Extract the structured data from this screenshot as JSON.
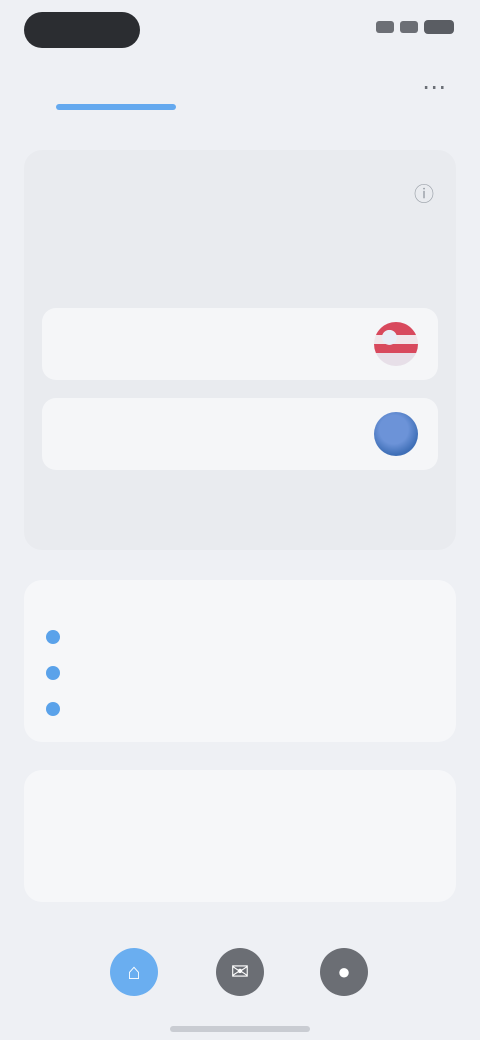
{
  "status_bar": {
    "icons": [
      "signal-icon",
      "wifi-icon",
      "battery-icon"
    ]
  },
  "top_nav": {
    "tabs": [
      {
        "label": ""
      },
      {
        "label": ""
      }
    ],
    "more_icon": "more-icon"
  },
  "connection_panel": {
    "title": "",
    "description": "",
    "options": [
      {
        "label": "",
        "icon": "us-flag-icon"
      },
      {
        "label": "",
        "icon": "uk-flag-icon"
      }
    ],
    "link": ""
  },
  "list_panel": {
    "items": [
      {
        "label": "",
        "value": ""
      },
      {
        "label": "",
        "value": ""
      },
      {
        "label": "",
        "value": ""
      }
    ]
  },
  "info_panel": {
    "heading": "",
    "text": ""
  },
  "tab_bar": {
    "items": [
      {
        "icon": "home-icon"
      },
      {
        "icon": "chat-icon"
      },
      {
        "icon": "profile-icon"
      }
    ]
  },
  "colors": {
    "accent": "#4a8fe6",
    "background": "#eef0f4",
    "card": "#f6f7f9"
  }
}
